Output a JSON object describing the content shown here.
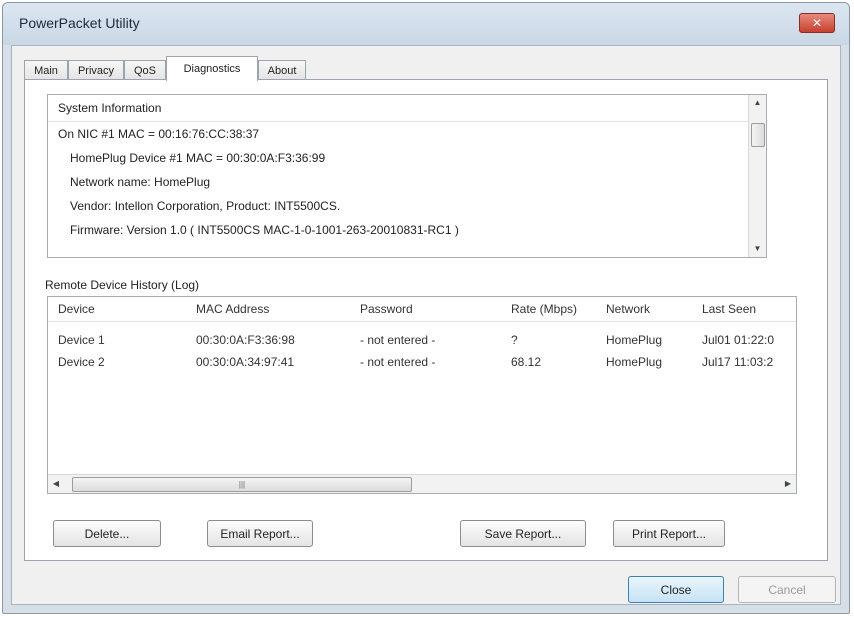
{
  "window": {
    "title": "PowerPacket Utility",
    "close_glyph": "✕"
  },
  "tabs": [
    {
      "label": "Main"
    },
    {
      "label": "Privacy"
    },
    {
      "label": "QoS"
    },
    {
      "label": "Diagnostics"
    },
    {
      "label": "About"
    }
  ],
  "active_tab": "Diagnostics",
  "system_info": {
    "lines": [
      "System Information",
      "On NIC #1 MAC = 00:16:76:CC:38:37",
      "HomePlug Device #1 MAC = 00:30:0A:F3:36:99",
      "Network name: HomePlug",
      "Vendor: Intellon Corporation, Product: INT5500CS.",
      "Firmware: Version 1.0   ( INT5500CS MAC-1-0-1001-263-20010831-RC1 )"
    ]
  },
  "remote_log": {
    "label": "Remote Device History (Log)",
    "columns": [
      "Device",
      "MAC Address",
      "Password",
      "Rate (Mbps)",
      "Network",
      "Last Seen"
    ],
    "rows": [
      [
        "Device 1",
        "00:30:0A:F3:36:98",
        "- not entered -",
        "?",
        "HomePlug",
        "Jul01 01:22:0"
      ],
      [
        "Device 2",
        "00:30:0A:34:97:41",
        "- not entered -",
        "68.12",
        "HomePlug",
        "Jul17 11:03:2"
      ]
    ]
  },
  "buttons": {
    "delete": "Delete...",
    "email_report": "Email Report...",
    "save_report": "Save Report...",
    "print_report": "Print Report...",
    "close": "Close",
    "cancel": "Cancel"
  },
  "colors": {
    "titlebar": "#c9d7e6",
    "close_button": "#c7402e",
    "default_button_border": "#3c7fb1"
  }
}
